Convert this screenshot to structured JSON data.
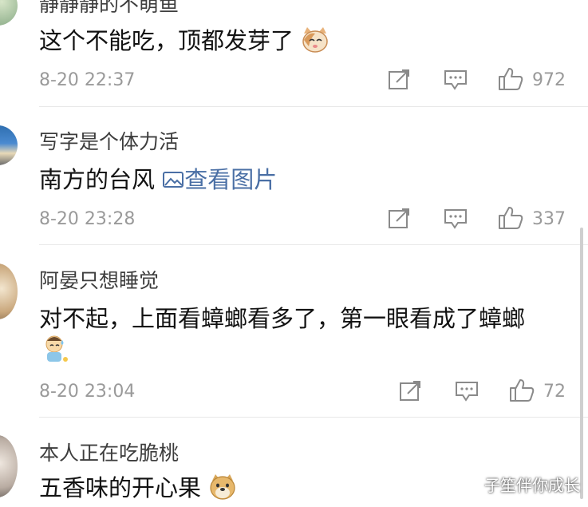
{
  "comments": [
    {
      "username": "静静静的不萌鱼",
      "text": "这个不能吃，顶都发芽了",
      "emoji": "cat-face-emoji",
      "time": "8-20 22:37",
      "likes": "972"
    },
    {
      "username": "写字是个体力活",
      "text": "南方的台风",
      "view_pic_label": "查看图片",
      "time": "8-20 23:28",
      "likes": "337"
    },
    {
      "username": "阿晏只想睡觉",
      "text": "对不起，上面看蟑螂看多了，第一眼看成了蟑螂",
      "emoji": "kid-sweat-emoji",
      "time": "8-20 23:04",
      "likes": "72"
    },
    {
      "username": "本人正在吃脆桃",
      "text": "五香味的开心果",
      "emoji": "doge-emoji"
    }
  ],
  "watermark": "子笙伴你成长",
  "colors": {
    "link": "#4a6fa5",
    "meta": "#9a9a9a",
    "divider": "#e8e8e8"
  }
}
